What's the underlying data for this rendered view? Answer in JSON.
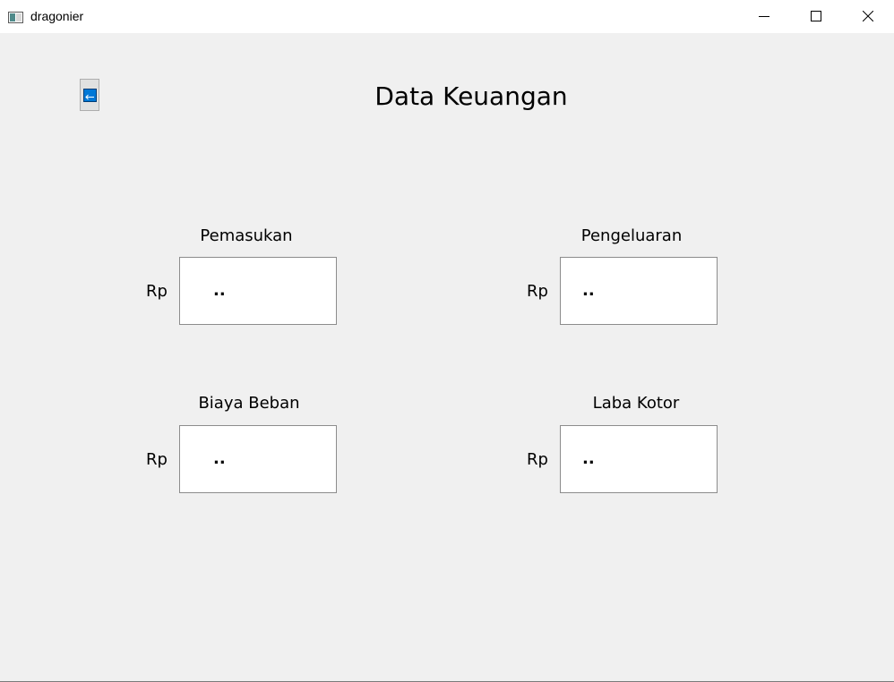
{
  "window": {
    "title": "dragonier"
  },
  "page": {
    "title": "Data Keuangan"
  },
  "fields": {
    "pemasukan": {
      "label": "Pemasukan",
      "currency": "Rp",
      "value": ".."
    },
    "pengeluaran": {
      "label": "Pengeluaran",
      "currency": "Rp",
      "value": ".."
    },
    "biaya_beban": {
      "label": "Biaya Beban",
      "currency": "Rp",
      "value": ".."
    },
    "laba_kotor": {
      "label": "Laba Kotor",
      "currency": "Rp",
      "value": ".."
    }
  },
  "icons": {
    "app": "app-window-icon",
    "back": "arrow-left-icon",
    "minimize": "minimize-icon",
    "maximize": "maximize-icon",
    "close": "close-icon"
  },
  "colors": {
    "background": "#f0f0f0",
    "titlebar": "#ffffff",
    "back_button_accent": "#0078d7"
  }
}
